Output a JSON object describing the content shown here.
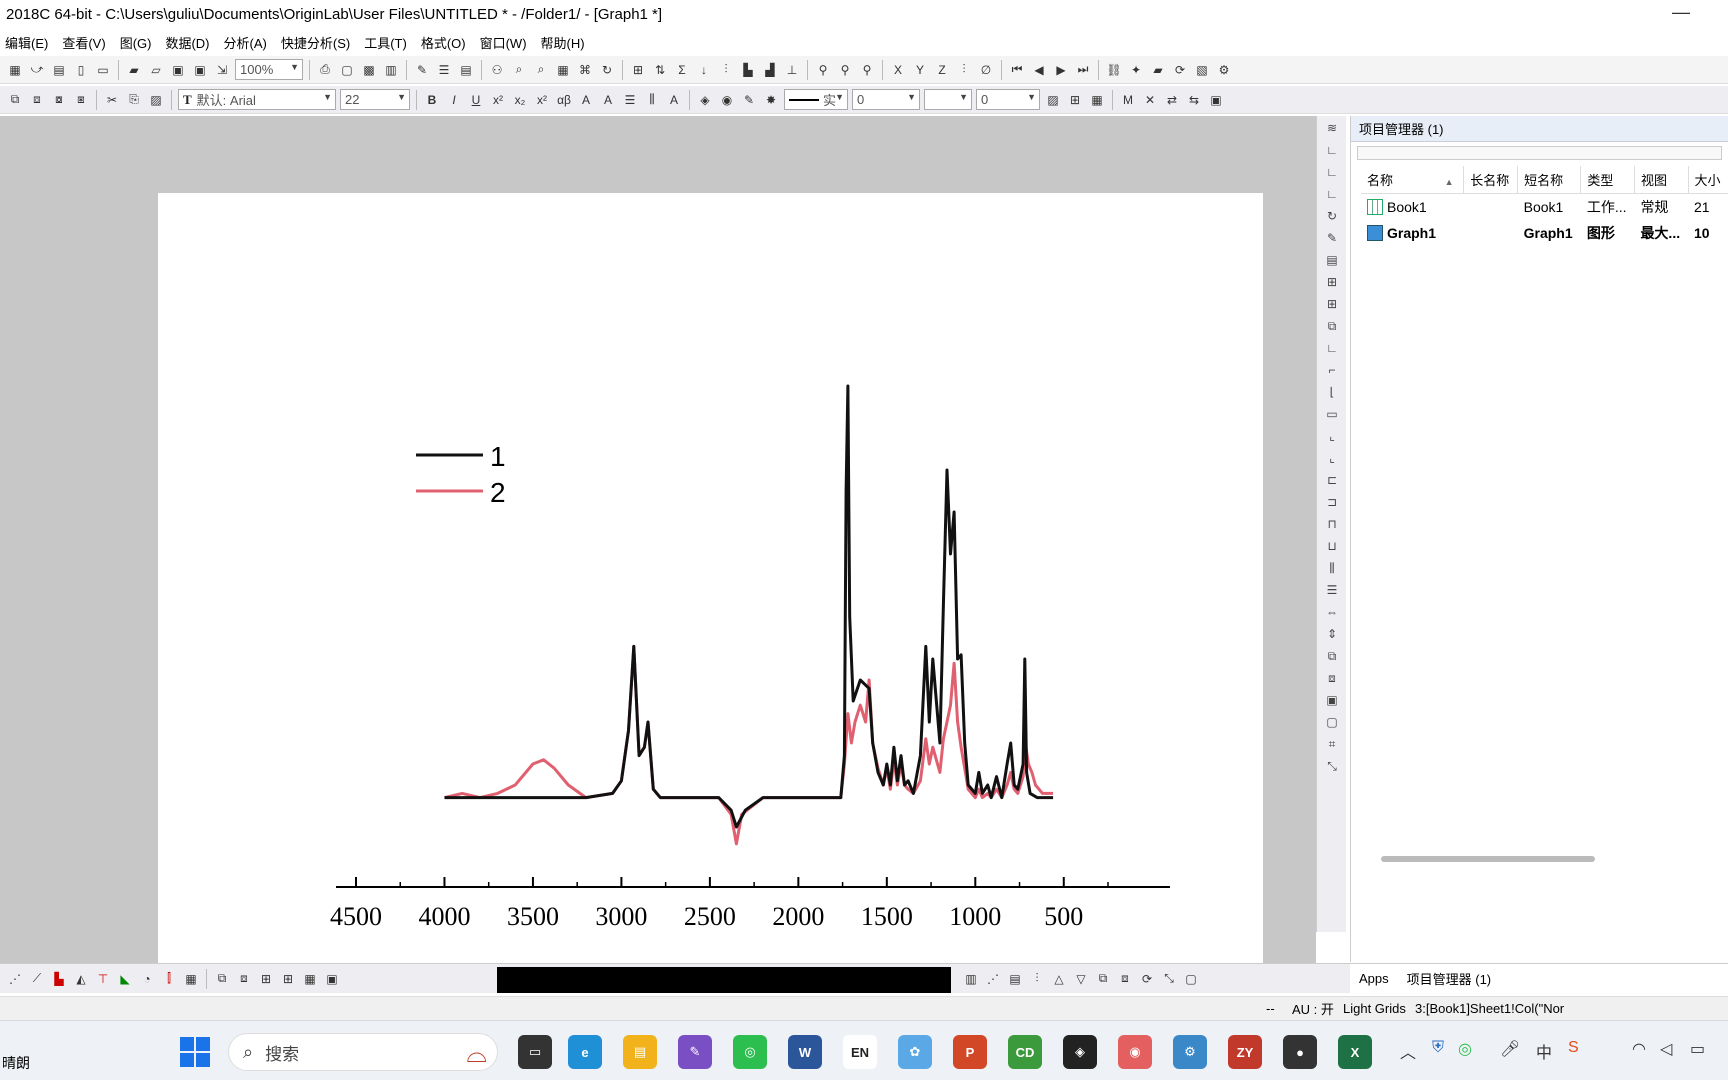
{
  "window": {
    "title": "2018C 64-bit - C:\\Users\\guliu\\Documents\\OriginLab\\User Files\\UNTITLED * - /Folder1/ - [Graph1 *]",
    "minimize_glyph": "—"
  },
  "menu": [
    "编辑(E)",
    "查看(V)",
    "图(G)",
    "数据(D)",
    "分析(A)",
    "快捷分析(S)",
    "工具(T)",
    "格式(O)",
    "窗口(W)",
    "帮助(H)"
  ],
  "toolbar1": {
    "zoom": "100%"
  },
  "toolbar2": {
    "font": "默认: Arial",
    "font_size": "22",
    "line_style": "实",
    "val1": "0",
    "val2": "0"
  },
  "project_manager": {
    "title": "项目管理器 (1)",
    "columns": [
      "名称",
      "长名称",
      "短名称",
      "类型",
      "视图",
      "大小"
    ],
    "rows": [
      {
        "name": "Book1",
        "long_name": "",
        "short_name": "Book1",
        "type": "工作...",
        "view": "常规",
        "size": "21",
        "icon": "workbook-icon",
        "bold": false
      },
      {
        "name": "Graph1",
        "long_name": "",
        "short_name": "Graph1",
        "type": "图形",
        "view": "最大...",
        "size": "10",
        "icon": "graph-icon",
        "bold": true
      }
    ]
  },
  "tabs": [
    "Apps",
    "项目管理器 (1)"
  ],
  "status": {
    "left": "--",
    "au": "AU : 开",
    "grids": "Light Grids",
    "cell": "3:[Book1]Sheet1!Col(\"Nor"
  },
  "taskbar": {
    "weather": "晴朗",
    "search_placeholder": "搜索",
    "apps": [
      {
        "name": "edge",
        "label": "e",
        "color": "#1f8fd6"
      },
      {
        "name": "explorer",
        "label": "▤",
        "color": "#f2b21b"
      },
      {
        "name": "paint",
        "label": "✎",
        "color": "#7a4fc4"
      },
      {
        "name": "wechat",
        "label": "◎",
        "color": "#2cbe4e"
      },
      {
        "name": "word",
        "label": "W",
        "color": "#2b579a"
      },
      {
        "name": "en",
        "label": "EN",
        "color": "#ffffff"
      },
      {
        "name": "app-ring",
        "label": "✿",
        "color": "#5aa9e6"
      },
      {
        "name": "powerpoint",
        "label": "P",
        "color": "#d24726"
      },
      {
        "name": "cd",
        "label": "CD",
        "color": "#3b9a3b"
      },
      {
        "name": "cube",
        "label": "◈",
        "color": "#222222"
      },
      {
        "name": "origin",
        "label": "◉",
        "color": "#e45f5f"
      },
      {
        "name": "gear-app",
        "label": "⚙",
        "color": "#3a88c7"
      },
      {
        "name": "zy",
        "label": "ZY",
        "color": "#c0392b"
      },
      {
        "name": "record",
        "label": "●",
        "color": "#333333"
      },
      {
        "name": "excel",
        "label": "X",
        "color": "#1e7145"
      }
    ],
    "ime_label": "中"
  },
  "chart_data": {
    "type": "line",
    "title": "",
    "xlabel": "",
    "ylabel": "",
    "xlim": [
      4500,
      250
    ],
    "x_ticks": [
      4500,
      4000,
      3500,
      3000,
      2500,
      2000,
      1500,
      1000,
      500
    ],
    "legend": {
      "position": "top-left",
      "entries": [
        "1",
        "2"
      ]
    },
    "series": [
      {
        "name": "1",
        "color": "#111111",
        "points": [
          [
            4000,
            0.02
          ],
          [
            3800,
            0.02
          ],
          [
            3600,
            0.02
          ],
          [
            3400,
            0.02
          ],
          [
            3200,
            0.02
          ],
          [
            3050,
            0.03
          ],
          [
            3000,
            0.06
          ],
          [
            2960,
            0.18
          ],
          [
            2930,
            0.38
          ],
          [
            2900,
            0.12
          ],
          [
            2870,
            0.14
          ],
          [
            2850,
            0.2
          ],
          [
            2820,
            0.04
          ],
          [
            2780,
            0.02
          ],
          [
            2600,
            0.02
          ],
          [
            2450,
            0.02
          ],
          [
            2380,
            -0.01
          ],
          [
            2350,
            -0.05
          ],
          [
            2300,
            -0.01
          ],
          [
            2200,
            0.02
          ],
          [
            1900,
            0.02
          ],
          [
            1760,
            0.02
          ],
          [
            1740,
            0.12
          ],
          [
            1730,
            0.75
          ],
          [
            1720,
            1.0
          ],
          [
            1710,
            0.45
          ],
          [
            1690,
            0.25
          ],
          [
            1650,
            0.3
          ],
          [
            1600,
            0.28
          ],
          [
            1580,
            0.15
          ],
          [
            1550,
            0.08
          ],
          [
            1520,
            0.05
          ],
          [
            1500,
            0.1
          ],
          [
            1480,
            0.05
          ],
          [
            1460,
            0.14
          ],
          [
            1440,
            0.06
          ],
          [
            1420,
            0.12
          ],
          [
            1400,
            0.05
          ],
          [
            1380,
            0.06
          ],
          [
            1350,
            0.03
          ],
          [
            1310,
            0.12
          ],
          [
            1280,
            0.38
          ],
          [
            1260,
            0.2
          ],
          [
            1240,
            0.35
          ],
          [
            1200,
            0.15
          ],
          [
            1180,
            0.48
          ],
          [
            1160,
            0.8
          ],
          [
            1140,
            0.6
          ],
          [
            1120,
            0.7
          ],
          [
            1100,
            0.35
          ],
          [
            1080,
            0.36
          ],
          [
            1060,
            0.15
          ],
          [
            1040,
            0.05
          ],
          [
            1000,
            0.03
          ],
          [
            980,
            0.08
          ],
          [
            960,
            0.03
          ],
          [
            930,
            0.05
          ],
          [
            910,
            0.02
          ],
          [
            880,
            0.07
          ],
          [
            850,
            0.02
          ],
          [
            820,
            0.1
          ],
          [
            800,
            0.15
          ],
          [
            780,
            0.05
          ],
          [
            760,
            0.04
          ],
          [
            730,
            0.1
          ],
          [
            720,
            0.35
          ],
          [
            710,
            0.08
          ],
          [
            690,
            0.03
          ],
          [
            650,
            0.02
          ],
          [
            600,
            0.02
          ],
          [
            560,
            0.02
          ]
        ]
      },
      {
        "name": "2",
        "color": "#e06070",
        "points": [
          [
            4000,
            0.02
          ],
          [
            3900,
            0.03
          ],
          [
            3800,
            0.02
          ],
          [
            3700,
            0.03
          ],
          [
            3600,
            0.05
          ],
          [
            3500,
            0.1
          ],
          [
            3440,
            0.11
          ],
          [
            3380,
            0.09
          ],
          [
            3300,
            0.05
          ],
          [
            3200,
            0.02
          ],
          [
            3050,
            0.03
          ],
          [
            3000,
            0.06
          ],
          [
            2960,
            0.18
          ],
          [
            2930,
            0.38
          ],
          [
            2900,
            0.12
          ],
          [
            2870,
            0.14
          ],
          [
            2850,
            0.2
          ],
          [
            2820,
            0.04
          ],
          [
            2780,
            0.02
          ],
          [
            2600,
            0.02
          ],
          [
            2450,
            0.02
          ],
          [
            2380,
            -0.02
          ],
          [
            2350,
            -0.09
          ],
          [
            2320,
            -0.02
          ],
          [
            2200,
            0.02
          ],
          [
            1900,
            0.02
          ],
          [
            1760,
            0.02
          ],
          [
            1740,
            0.1
          ],
          [
            1720,
            0.22
          ],
          [
            1700,
            0.15
          ],
          [
            1680,
            0.2
          ],
          [
            1650,
            0.24
          ],
          [
            1620,
            0.2
          ],
          [
            1600,
            0.3
          ],
          [
            1580,
            0.15
          ],
          [
            1550,
            0.09
          ],
          [
            1520,
            0.05
          ],
          [
            1500,
            0.09
          ],
          [
            1480,
            0.04
          ],
          [
            1460,
            0.11
          ],
          [
            1440,
            0.05
          ],
          [
            1420,
            0.1
          ],
          [
            1400,
            0.05
          ],
          [
            1380,
            0.04
          ],
          [
            1350,
            0.03
          ],
          [
            1310,
            0.06
          ],
          [
            1280,
            0.16
          ],
          [
            1260,
            0.1
          ],
          [
            1240,
            0.14
          ],
          [
            1200,
            0.08
          ],
          [
            1180,
            0.16
          ],
          [
            1160,
            0.2
          ],
          [
            1140,
            0.24
          ],
          [
            1120,
            0.34
          ],
          [
            1100,
            0.2
          ],
          [
            1080,
            0.14
          ],
          [
            1060,
            0.09
          ],
          [
            1040,
            0.04
          ],
          [
            1000,
            0.02
          ],
          [
            980,
            0.04
          ],
          [
            960,
            0.02
          ],
          [
            930,
            0.03
          ],
          [
            910,
            0.02
          ],
          [
            880,
            0.04
          ],
          [
            850,
            0.02
          ],
          [
            820,
            0.05
          ],
          [
            800,
            0.08
          ],
          [
            780,
            0.04
          ],
          [
            760,
            0.03
          ],
          [
            730,
            0.07
          ],
          [
            720,
            0.16
          ],
          [
            700,
            0.1
          ],
          [
            680,
            0.08
          ],
          [
            660,
            0.05
          ],
          [
            620,
            0.03
          ],
          [
            580,
            0.03
          ],
          [
            560,
            0.03
          ]
        ]
      }
    ]
  }
}
